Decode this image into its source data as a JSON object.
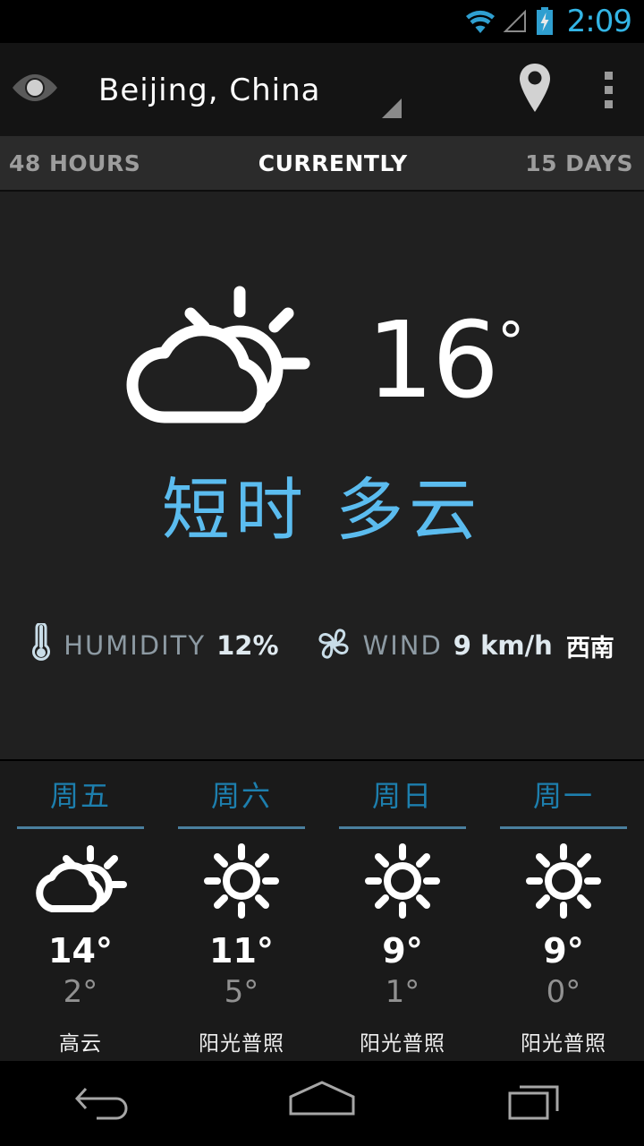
{
  "statusbar": {
    "time": "2:09",
    "accent_color": "#33b5e5",
    "icons": [
      "wifi-icon",
      "cell-signal-icon",
      "battery-charging-icon"
    ]
  },
  "actionbar": {
    "title": "Beijing, China",
    "eye_icon": "eye-icon",
    "spinner_icon": "dropdown-triangle-icon",
    "location_icon": "location-pin-icon",
    "overflow_icon": "overflow-menu-icon"
  },
  "tabs": [
    {
      "label": "48 HOURS",
      "active": false
    },
    {
      "label": "CURRENTLY",
      "active": true
    },
    {
      "label": "15 DAYS",
      "active": false
    }
  ],
  "current": {
    "icon": "partly-cloudy-icon",
    "temperature": "16",
    "degree": "°",
    "condition": "短时 多云",
    "condition_color": "#5bbcef",
    "humidity": {
      "icon": "thermometer-icon",
      "label": "HUMIDITY",
      "value": "12%"
    },
    "wind": {
      "icon": "wind-fan-icon",
      "label": "WIND",
      "value": "9 km/h",
      "direction": "西南"
    }
  },
  "forecast": [
    {
      "day": "周五",
      "icon": "partly-cloudy-icon",
      "high": "14°",
      "low": "2°",
      "condition": "高云"
    },
    {
      "day": "周六",
      "icon": "sunny-icon",
      "high": "11°",
      "low": "5°",
      "condition": "阳光普照"
    },
    {
      "day": "周日",
      "icon": "sunny-icon",
      "high": "9°",
      "low": "1°",
      "condition": "阳光普照"
    },
    {
      "day": "周一",
      "icon": "sunny-icon",
      "high": "9°",
      "low": "0°",
      "condition": "阳光普照"
    }
  ],
  "navbar": {
    "back": "back-icon",
    "home": "home-icon",
    "recents": "recents-icon"
  },
  "colors": {
    "background": "#202020",
    "panel": "#1a1a1a",
    "tabbar": "#2b2b2b",
    "actionbar": "#141414",
    "accent_blue": "#5bbcef",
    "day_blue": "#1d7fae",
    "rule_blue": "#4a7f9e"
  }
}
